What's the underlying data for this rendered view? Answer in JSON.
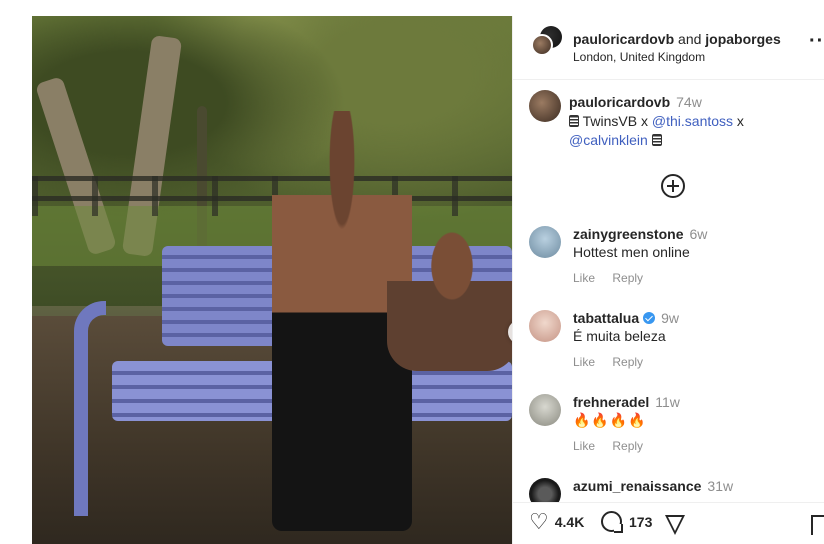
{
  "post": {
    "header": {
      "user1": "pauloricardovb",
      "conjunction": "and",
      "user2": "jopaborges",
      "location": "London, United Kingdom",
      "more_icon": "more-horizontal-icon"
    },
    "caption": {
      "username": "pauloricardovb",
      "time": "74w",
      "text_a": "TwinsVB x",
      "mention1": "@thi.santoss",
      "text_b": "x",
      "mention2": "@calvinklein"
    },
    "comments": [
      {
        "username": "zainygreenstone",
        "time": "6w",
        "text": "Hottest men online",
        "like": "Like",
        "reply": "Reply",
        "verified": false
      },
      {
        "username": "tabattalua",
        "time": "9w",
        "text": "É muita beleza",
        "like": "Like",
        "reply": "Reply",
        "verified": true
      },
      {
        "username": "frehneradel",
        "time": "11w",
        "text": "🔥🔥🔥🔥",
        "like": "Like",
        "reply": "Reply",
        "verified": false
      },
      {
        "username": "azumi_renaissance",
        "time": "31w",
        "text": "",
        "verified": false
      }
    ],
    "footer": {
      "likes": "4.4K",
      "comments": "173"
    },
    "image": {
      "next_icon": "chevron-right-icon"
    }
  }
}
